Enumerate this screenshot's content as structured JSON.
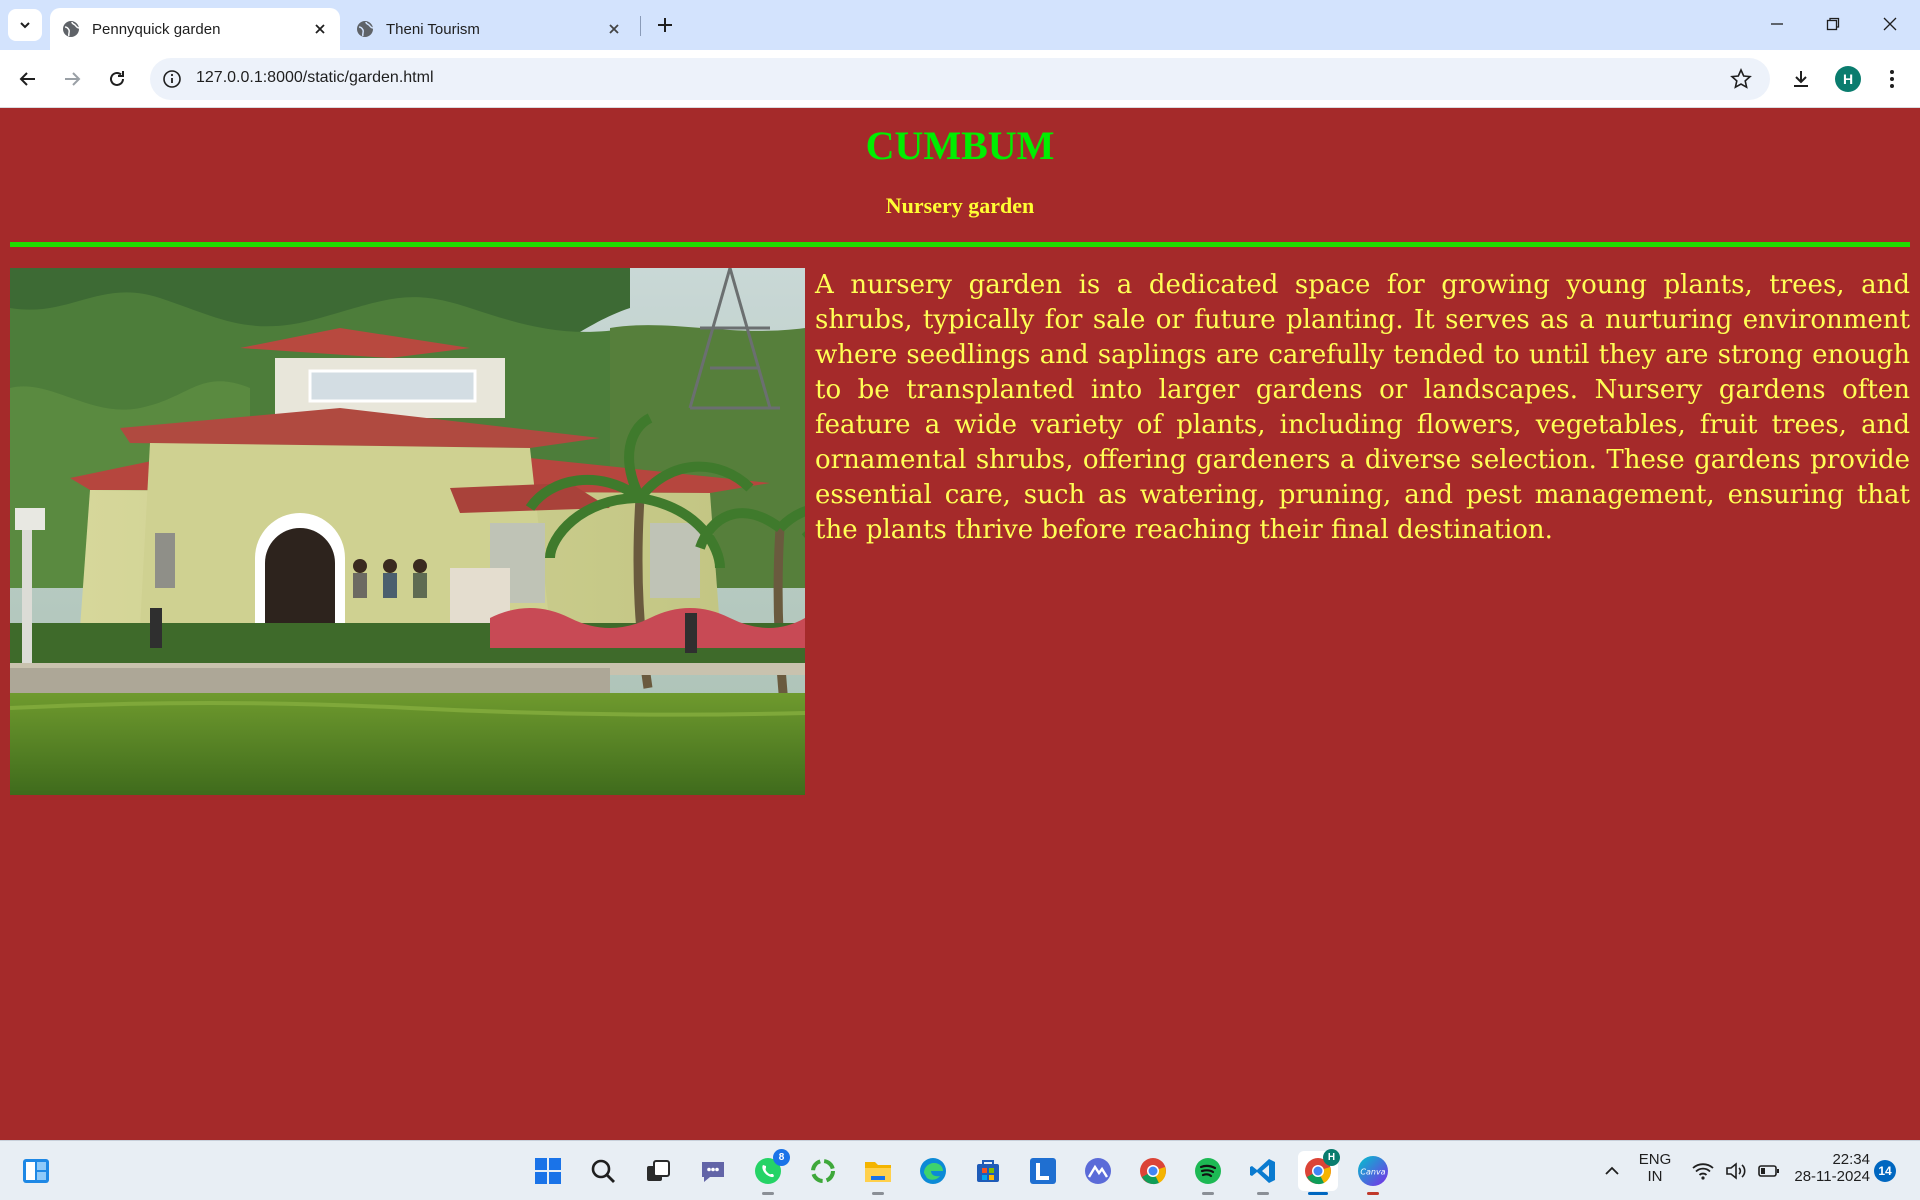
{
  "browser": {
    "tabs": [
      {
        "title": "Pennyquick garden",
        "active": true
      },
      {
        "title": "Theni Tourism",
        "active": false
      }
    ],
    "url": "127.0.0.1:8000/static/garden.html",
    "profile_initial": "H"
  },
  "page": {
    "heading": "CUMBUM",
    "subheading": "Nursery garden",
    "paragraph": "A nursery garden is a dedicated space for growing young plants, trees, and shrubs, typically for sale or future planting. It serves as a nurturing environment where seedlings and saplings are carefully tended to until they are strong enough to be transplanted into larger gardens or landscapes. Nursery gardens often feature a wide variety of plants, including flowers, vegetables, fruit trees, and ornamental shrubs, offering gardeners a diverse selection. These gardens provide essential care, such as watering, pruning, and pest management, ensuring that the plants thrive before reaching their final destination.",
    "colors": {
      "background": "#a52a2a",
      "heading": "#00ee00",
      "subheading": "#ffff33",
      "rule": "#22dd00",
      "text": "#ffff55"
    }
  },
  "taskbar": {
    "whatsapp_badge": "8",
    "chrome_profile_badge": "H",
    "canva_label": "Canva",
    "language": "ENG",
    "region": "IN",
    "time": "22:34",
    "date": "28-11-2024",
    "notification_count": "14"
  }
}
